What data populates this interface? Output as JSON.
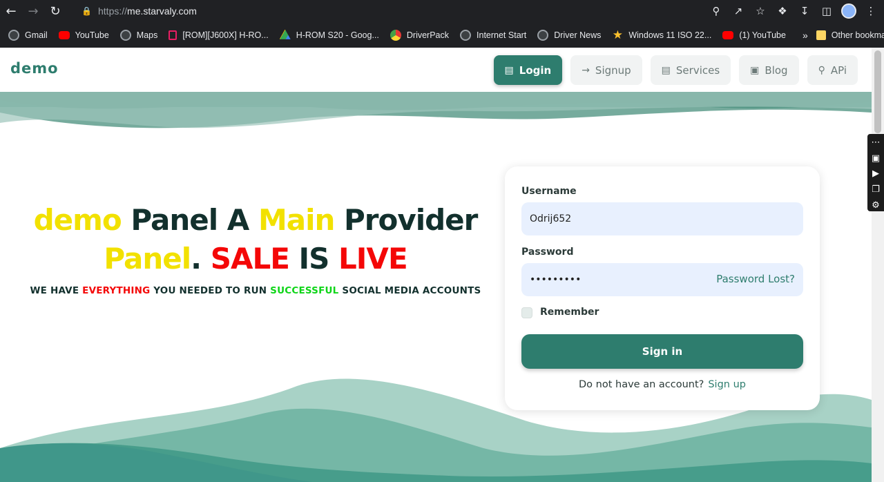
{
  "browser": {
    "url_scheme": "https://",
    "url_host": "me.starvaly.com",
    "bookmarks": [
      {
        "label": "Gmail",
        "icon": "globe-icon"
      },
      {
        "label": "YouTube",
        "icon": "youtube-icon"
      },
      {
        "label": "Maps",
        "icon": "globe-icon"
      },
      {
        "label": "[ROM][J600X] H-RO...",
        "icon": "rom-icon"
      },
      {
        "label": "H-ROM S20 - Goog...",
        "icon": "drive-icon"
      },
      {
        "label": "DriverPack",
        "icon": "driverpack-icon"
      },
      {
        "label": "Internet Start",
        "icon": "globe-icon"
      },
      {
        "label": "Driver News",
        "icon": "globe-icon"
      },
      {
        "label": "Windows 11 ISO 22...",
        "icon": "star-icon"
      },
      {
        "label": "(1) YouTube",
        "icon": "youtube-icon"
      }
    ],
    "other_bookmarks": "Other bookmarks",
    "more": "»"
  },
  "nav": {
    "brand": "demo",
    "buttons": [
      {
        "label": "Login",
        "icon": "id-card-icon",
        "active": true
      },
      {
        "label": "Signup",
        "icon": "arrow-right-icon",
        "active": false
      },
      {
        "label": "Services",
        "icon": "document-icon",
        "active": false
      },
      {
        "label": "Blog",
        "icon": "blog-icon",
        "active": false
      },
      {
        "label": "APi",
        "icon": "plug-icon",
        "active": false
      }
    ]
  },
  "hero": {
    "t1": "demo",
    "t2": " Panel A ",
    "t3": "Main",
    "t4": " Provider",
    "t5": "Panel",
    "t6": ". ",
    "t7": "SALE",
    "t8": " IS ",
    "t9": "LIVE",
    "s1": "WE HAVE ",
    "s2": "EVERYTHING",
    "s3": " YOU NEEDED TO RUN ",
    "s4": "SUCCESSFUL",
    "s5": " SOCIAL MEDIA ACCOUNTS"
  },
  "login": {
    "username_label": "Username",
    "username_value": "Odrij652",
    "password_label": "Password",
    "password_value": "•••••••••",
    "password_lost": "Password Lost?",
    "remember_label": "Remember",
    "signin_label": "Sign in",
    "no_account": "Do not have an account?",
    "signup_link": "Sign up"
  },
  "colors": {
    "primary": "#2e7d6e",
    "yellow": "#f2e100",
    "red": "#f40707",
    "green": "#0ed518"
  }
}
